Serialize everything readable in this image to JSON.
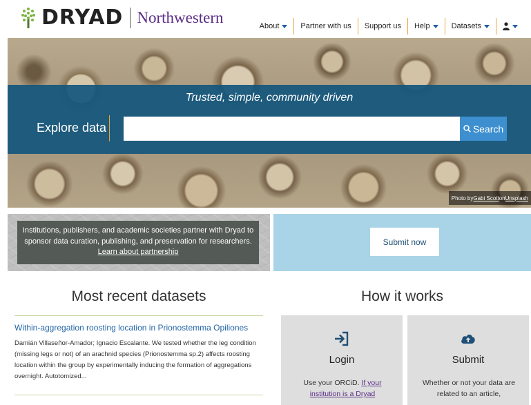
{
  "header": {
    "logo_word": "DRYAD",
    "institution": "Northwestern",
    "nav": {
      "about": "About",
      "partner": "Partner with us",
      "support": "Support us",
      "help": "Help",
      "datasets": "Datasets"
    }
  },
  "hero": {
    "tagline": "Trusted, simple, community driven",
    "explore_label": "Explore data",
    "search_placeholder": "",
    "search_button": "Search",
    "photo_credit_prefix": "Photo by ",
    "photo_credit_author": "Gabi Scott",
    "photo_credit_on": " on ",
    "photo_credit_site": "Unsplash"
  },
  "partner": {
    "text": "Institutions, publishers, and academic societies partner with Dryad to sponsor data curation, publishing, and preservation for researchers.",
    "link": "Learn about partnership"
  },
  "submit_banner": {
    "button": "Submit now"
  },
  "recent": {
    "title": "Most recent datasets",
    "items": [
      {
        "title": "Within-aggregation roosting location in Prionostemma Opiliones",
        "description": "Damián Villaseñor-Amador; Ignacio Escalante. We tested whether the leg condition (missing legs or not) of an arachnid species (Prionostemma sp.2) affects roosting location within the group by experimentally inducing the formation of aggregations overnight. Autotomized..."
      }
    ]
  },
  "how": {
    "title": "How it works",
    "cards": [
      {
        "icon": "sign-in-icon",
        "title": "Login",
        "text_prefix": "Use your ORCiD. ",
        "text_link": "If your institution is a Dryad"
      },
      {
        "icon": "cloud-upload-icon",
        "title": "Submit",
        "text": "Whether or not your data are related to an article,"
      }
    ]
  },
  "colors": {
    "brand_purple": "#5b2d86",
    "band_blue": "#12567d",
    "search_blue": "#3d8fcf",
    "nav_divider": "#e8a33b",
    "link_blue": "#2466a8"
  }
}
